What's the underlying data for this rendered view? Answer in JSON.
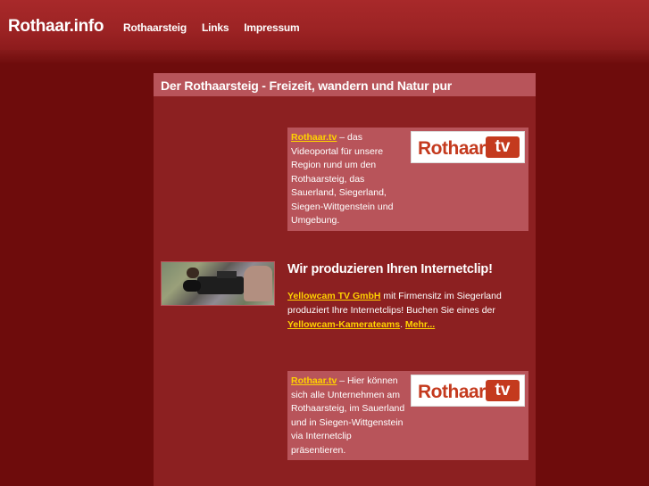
{
  "header": {
    "logo": "Rothaar.info",
    "nav": [
      "Rothaarsteig",
      "Links",
      "Impressum"
    ]
  },
  "page": {
    "title": "Der Rothaarsteig - Freizeit, wandern und Natur pur"
  },
  "promo1": {
    "link": "Rothaar.tv",
    "text": " – das Videoportal für unsere Region rund um den Rothaarsteig, das Sauerland, Siegerland, Siegen-Wittgenstein und Umgebung.",
    "logo_text": "Rothaar.",
    "logo_box": "tv"
  },
  "yellowcam": {
    "heading": "Wir produzieren Ihren Internetclip!",
    "link1": "Yellowcam TV GmbH",
    "text1": " mit Firmensitz im Siegerland produziert Ihre Internetclips! Buchen Sie eines der ",
    "link2": "Yellowcam-Kamerateams",
    "text2": ". ",
    "link3": "Mehr..."
  },
  "promo2": {
    "link": "Rothaar.tv",
    "text": " – Hier können sich alle Unternehmen am Rothaarsteig, im Sauerland und in Siegen-Wittgenstein via Internetclip präsentieren.",
    "logo_text": "Rothaar.",
    "logo_box": "tv"
  },
  "colors": {
    "background": "#6e0c0c",
    "header": "#9c2324",
    "content": "#8c2021",
    "box": "#b8545a",
    "link": "#ffd200",
    "logo_red": "#c43a1e"
  }
}
